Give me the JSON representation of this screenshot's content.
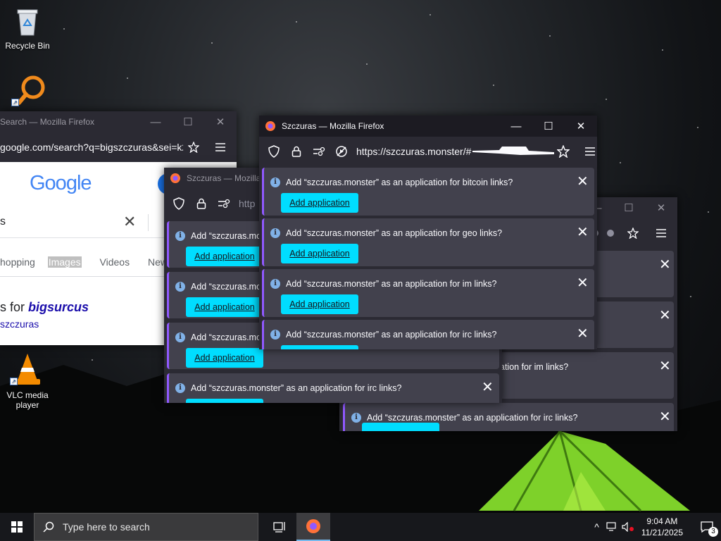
{
  "desktop": {
    "icons": [
      {
        "label": "Recycle Bin",
        "icon": "recycle-bin-icon"
      },
      {
        "label": "",
        "icon": "search-app-icon"
      },
      {
        "label": "VLC media player",
        "icon": "vlc-icon"
      }
    ]
  },
  "window_google": {
    "title": "Search — Mozilla Firefox",
    "url": "google.com/search?q=bigszczuras&sei=k2",
    "logo": "Google",
    "search_value": "s",
    "tabs": [
      "hopping",
      "Images",
      "Videos",
      "New"
    ],
    "result_prefix": "s for ",
    "result_bold": "bigsurcus",
    "result_link": "szczuras"
  },
  "window_2": {
    "title": "Szczuras — Mozilla F",
    "url_partial": "http",
    "notifications": [
      {
        "text": "Add “szczuras.mon",
        "button": "Add application"
      },
      {
        "text": "Add “szczuras.mor",
        "button": "Add application"
      },
      {
        "text": "Add “szczuras.mor",
        "button": "Add application"
      },
      {
        "text": "Add “szczuras.monster” as an application for irc links?",
        "button": ""
      }
    ]
  },
  "window_3": {
    "notifications": [
      {
        "text": "",
        "button": ""
      },
      {
        "text": "",
        "button": ""
      },
      {
        "text": "ation for im links?",
        "button": ""
      },
      {
        "text": "Add “szczuras.monster” as an application for irc links?",
        "button": ""
      }
    ]
  },
  "window_main": {
    "title": "Szczuras — Mozilla Firefox",
    "url": "https://szczuras.monster/#",
    "notifications": [
      {
        "text": "Add “szczuras.monster” as an application for bitcoin links?",
        "button": "Add application"
      },
      {
        "text": "Add “szczuras.monster” as an application for geo links?",
        "button": "Add application"
      },
      {
        "text": "Add “szczuras.monster” as an application for im links?",
        "button": "Add application"
      },
      {
        "text": "Add “szczuras.monster” as an application for irc links?",
        "button": ""
      }
    ]
  },
  "taskbar": {
    "search_placeholder": "Type here to search",
    "time": "9:04 AM",
    "date": "11/21/2025",
    "notification_count": "3"
  },
  "colors": {
    "accent_button": "#00ddff",
    "notification_bg": "#42414d",
    "window_bg": "#2b2a33",
    "notification_stripe": "#9059ff"
  }
}
